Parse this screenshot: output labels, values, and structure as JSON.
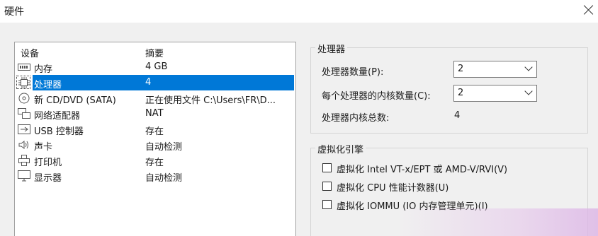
{
  "window": {
    "title": "硬件"
  },
  "device_list": {
    "headers": {
      "device": "设备",
      "summary": "摘要"
    },
    "rows": [
      {
        "icon": "memory-icon",
        "name": "内存",
        "summary": "4 GB"
      },
      {
        "icon": "processor-icon",
        "name": "处理器",
        "summary": "4"
      },
      {
        "icon": "cd-dvd-icon",
        "name": "新 CD/DVD (SATA)",
        "summary": "正在使用文件 C:\\Users\\FR\\D..."
      },
      {
        "icon": "network-adapter-icon",
        "name": "网络适配器",
        "summary": "NAT"
      },
      {
        "icon": "usb-controller-icon",
        "name": "USB 控制器",
        "summary": "存在"
      },
      {
        "icon": "sound-card-icon",
        "name": "声卡",
        "summary": "自动检测"
      },
      {
        "icon": "printer-icon",
        "name": "打印机",
        "summary": "存在"
      },
      {
        "icon": "display-icon",
        "name": "显示器",
        "summary": "自动检测"
      }
    ],
    "selected_index": 1,
    "selection_color": "#0078d7"
  },
  "processor_group": {
    "title": "处理器",
    "count_label": "处理器数量(P):",
    "count_value": "2",
    "cores_label": "每个处理器的内核数量(C):",
    "cores_value": "2",
    "total_label": "处理器内核总数:",
    "total_value": "4"
  },
  "virtualization_group": {
    "title": "虚拟化引擎",
    "options": [
      {
        "label": "虚拟化 Intel VT-x/EPT 或 AMD-V/RVI(V)",
        "checked": false
      },
      {
        "label": "虚拟化 CPU 性能计数器(U)",
        "checked": false
      },
      {
        "label": "虚拟化 IOMMU (IO 内存管理单元)(I)",
        "checked": false
      }
    ]
  }
}
